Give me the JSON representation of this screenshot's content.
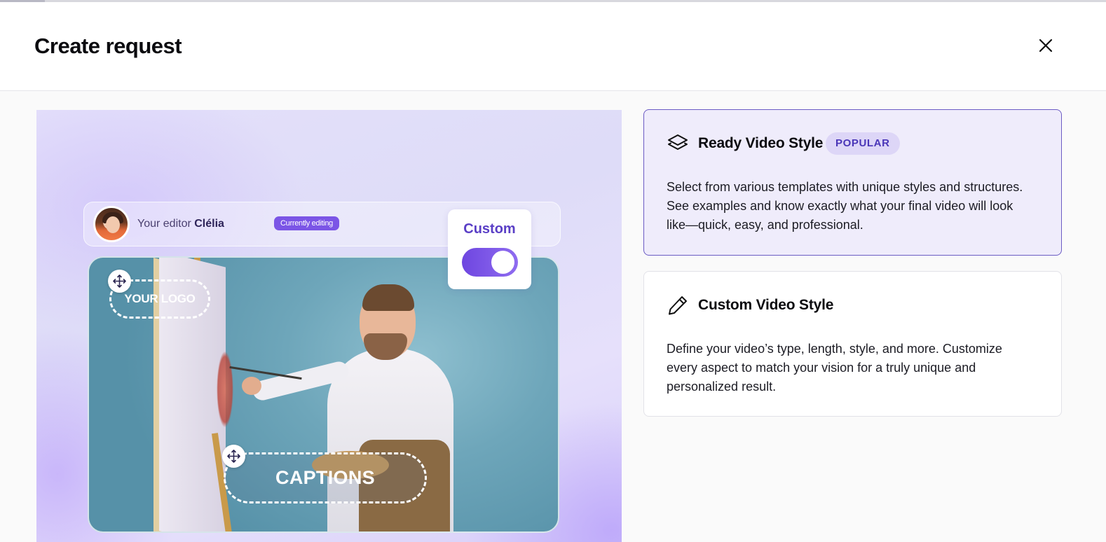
{
  "dialog": {
    "title": "Create request",
    "close_label": "Close"
  },
  "preview": {
    "editor_prefix": "Your editor",
    "editor_name": "Clélia",
    "editing_badge": "Currently editing",
    "custom_label": "Custom",
    "toggle_on": true,
    "logo_placeholder": "YOUR LOGO",
    "captions_placeholder": "CAPTIONS"
  },
  "options": [
    {
      "icon": "layers-icon",
      "title": "Ready Video Style",
      "badge": "POPULAR",
      "description": "Select from various templates with unique styles and structures. See examples and know exactly what your final video will look like—quick, easy, and professional.",
      "selected": true
    },
    {
      "icon": "pencil-icon",
      "title": "Custom Video Style",
      "description": "Define your video’s type, length, style, and more. Customize every aspect to match your vision for a truly unique and personalized result.",
      "selected": false
    }
  ],
  "colors": {
    "accent": "#7b55e6",
    "selected_border": "#6b5bc4",
    "selected_bg": "#efecfb",
    "badge_bg": "#ddd6f7",
    "badge_text": "#4a36b8"
  }
}
